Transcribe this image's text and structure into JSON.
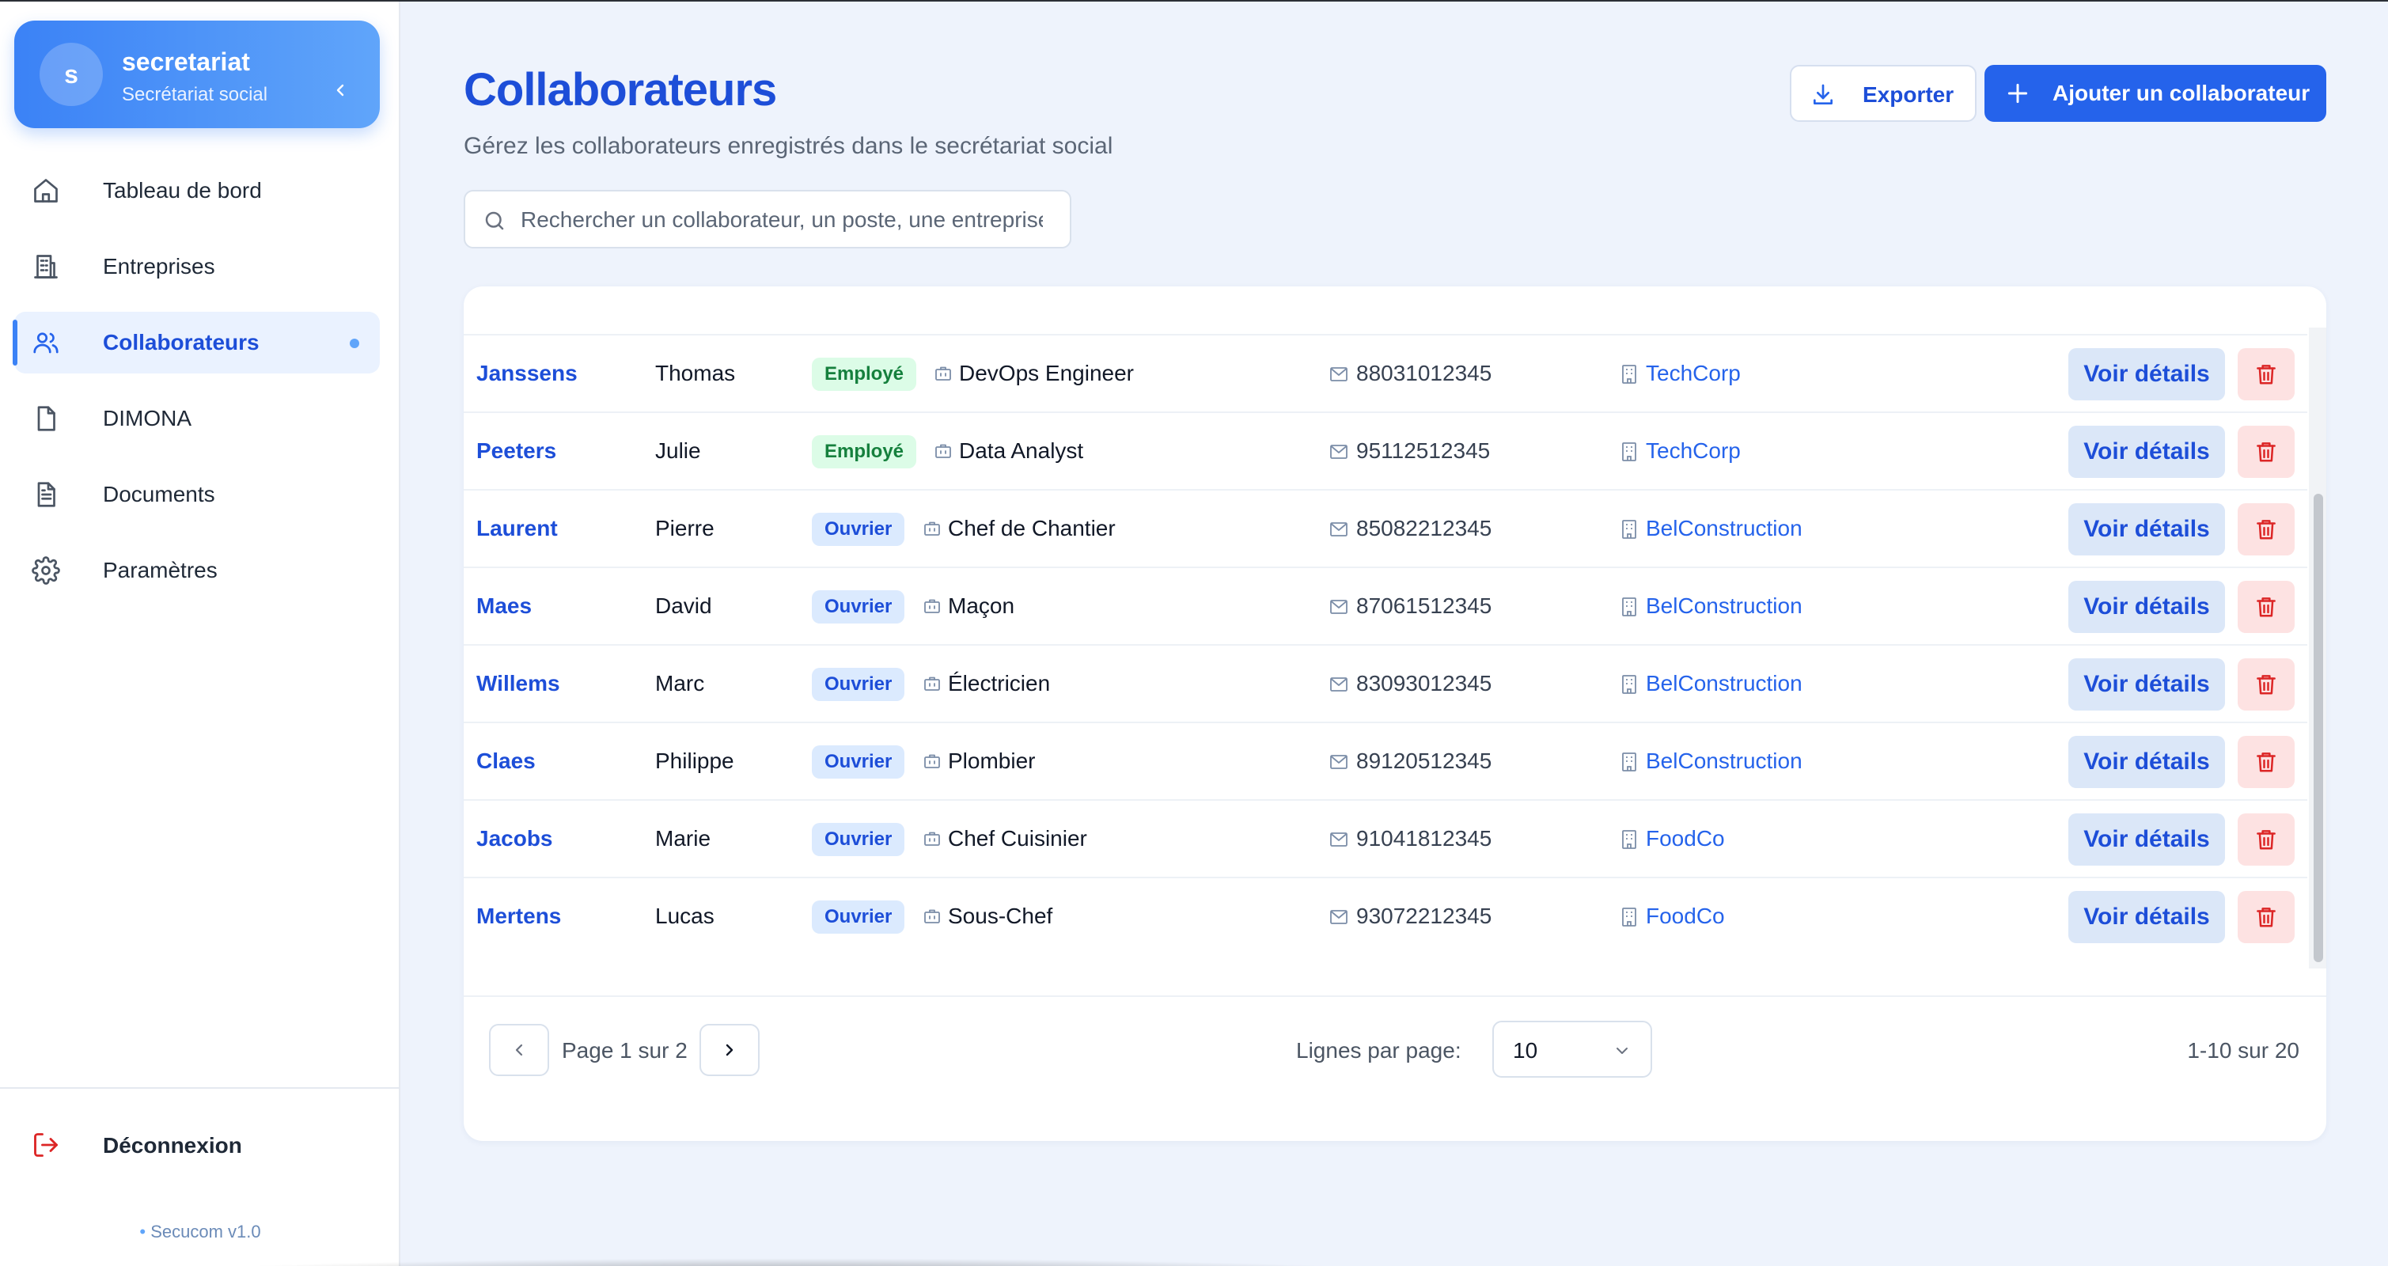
{
  "brand": {
    "avatar_letter": "s",
    "title": "secretariat",
    "subtitle": "Secrétariat social"
  },
  "nav": {
    "items": [
      {
        "label": "Tableau de bord",
        "icon": "home-icon"
      },
      {
        "label": "Entreprises",
        "icon": "building-icon"
      },
      {
        "label": "Collaborateurs",
        "icon": "users-icon",
        "active": true
      },
      {
        "label": "DIMONA",
        "icon": "file-icon"
      },
      {
        "label": "Documents",
        "icon": "document-text-icon"
      },
      {
        "label": "Paramètres",
        "icon": "gear-icon"
      }
    ],
    "logout": "Déconnexion",
    "version": "Secucom v1.0"
  },
  "header": {
    "title": "Collaborateurs",
    "subtitle": "Gérez les collaborateurs enregistrés dans le secrétariat social",
    "export_label": "Exporter",
    "add_label": "Ajouter un collaborateur"
  },
  "search": {
    "placeholder": "Rechercher un collaborateur, un poste, une entreprise...",
    "value": ""
  },
  "table": {
    "view_label": "Voir détails",
    "rows": [
      {
        "last": "Janssens",
        "first": "Thomas",
        "type": "Employé",
        "position": "DevOps Engineer",
        "nis": "88031012345",
        "company": "TechCorp"
      },
      {
        "last": "Peeters",
        "first": "Julie",
        "type": "Employé",
        "position": "Data Analyst",
        "nis": "95112512345",
        "company": "TechCorp"
      },
      {
        "last": "Laurent",
        "first": "Pierre",
        "type": "Ouvrier",
        "position": "Chef de Chantier",
        "nis": "85082212345",
        "company": "BelConstruction"
      },
      {
        "last": "Maes",
        "first": "David",
        "type": "Ouvrier",
        "position": "Maçon",
        "nis": "87061512345",
        "company": "BelConstruction"
      },
      {
        "last": "Willems",
        "first": "Marc",
        "type": "Ouvrier",
        "position": "Électricien",
        "nis": "83093012345",
        "company": "BelConstruction"
      },
      {
        "last": "Claes",
        "first": "Philippe",
        "type": "Ouvrier",
        "position": "Plombier",
        "nis": "89120512345",
        "company": "BelConstruction"
      },
      {
        "last": "Jacobs",
        "first": "Marie",
        "type": "Ouvrier",
        "position": "Chef Cuisinier",
        "nis": "91041812345",
        "company": "FoodCo"
      },
      {
        "last": "Mertens",
        "first": "Lucas",
        "type": "Ouvrier",
        "position": "Sous-Chef",
        "nis": "93072212345",
        "company": "FoodCo"
      }
    ]
  },
  "pagination": {
    "page_text": "Page 1 sur 2",
    "rows_per_page_label": "Lignes par page:",
    "rows_per_page_value": "10",
    "count_text": "1-10 sur 20"
  },
  "colors": {
    "accent": "#2563eb",
    "employe_badge_bg": "#dcfce7",
    "ouvrier_badge_bg": "#dbeafe",
    "danger_bg": "#fde2e2"
  }
}
